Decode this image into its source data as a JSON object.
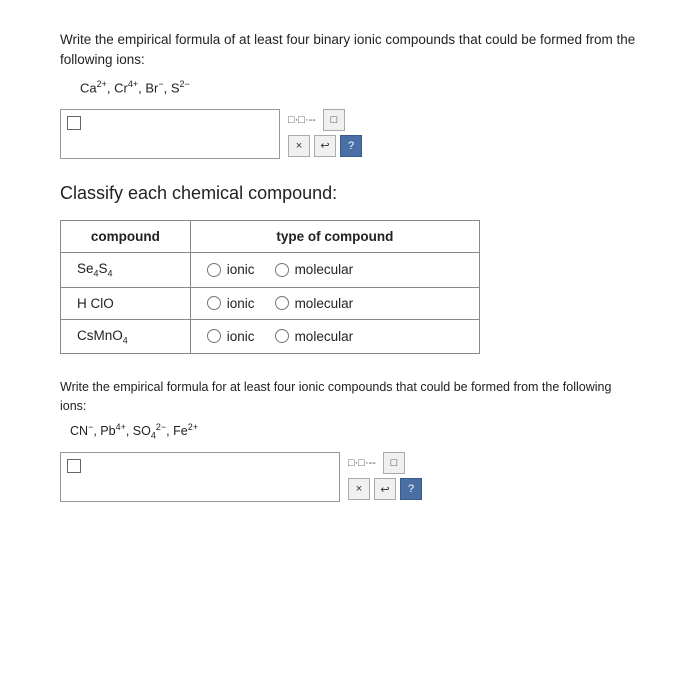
{
  "section1": {
    "question": "Write the empirical formula of at least four binary ionic compounds that could be formed from the following ions:",
    "ions_display": "Ca²⁺, Cr⁴⁺, Br⁻, S²⁻"
  },
  "classify": {
    "heading": "Classify each chemical compound:",
    "table": {
      "col1_header": "compound",
      "col2_header": "type of compound",
      "rows": [
        {
          "compound": "Se₄S₄",
          "compound_label": "Se4S4"
        },
        {
          "compound": "HClO",
          "compound_label": "HClO"
        },
        {
          "compound": "CsMnO₄",
          "compound_label": "CsMnO4"
        }
      ],
      "radio_option1": "ionic",
      "radio_option2": "molecular"
    }
  },
  "section2": {
    "question": "Write the empirical formula for at least four ionic compounds that could be formed from the following ions:",
    "ions_display": "CN⁻, Pb⁴⁺, SO₄²⁻, Fe²⁺"
  },
  "toolbar": {
    "icon_label": "□·□·--",
    "icon2_label": "□",
    "btn_x": "×",
    "btn_undo": "↩",
    "btn_help": "?"
  }
}
